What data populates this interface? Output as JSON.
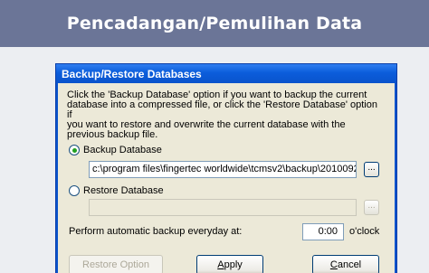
{
  "banner": {
    "title": "Pencadangan/Pemulihan Data"
  },
  "dialog": {
    "title": "Backup/Restore Databases",
    "description": "Click the 'Backup Database' option if you want to backup the current\ndatabase into a compressed file, or click the 'Restore Database' option if\nyou want to restore and overwrite the current database with the\nprevious backup file.",
    "backup_option": {
      "label": "Backup Database",
      "selected": true,
      "path": "c:\\program files\\fingertec worldwide\\tcmsv2\\backup\\2010092"
    },
    "restore_option": {
      "label": "Restore Database",
      "selected": false,
      "path": ""
    },
    "browse_label": "...",
    "auto_backup_label": "Perform automatic backup everyday at:",
    "auto_backup_time": "0:00",
    "oclock_label": "o'clock",
    "buttons": {
      "restore_option": "Restore Option",
      "apply_first": "A",
      "apply_rest": "pply",
      "cancel_first": "C",
      "cancel_rest": "ancel"
    }
  }
}
